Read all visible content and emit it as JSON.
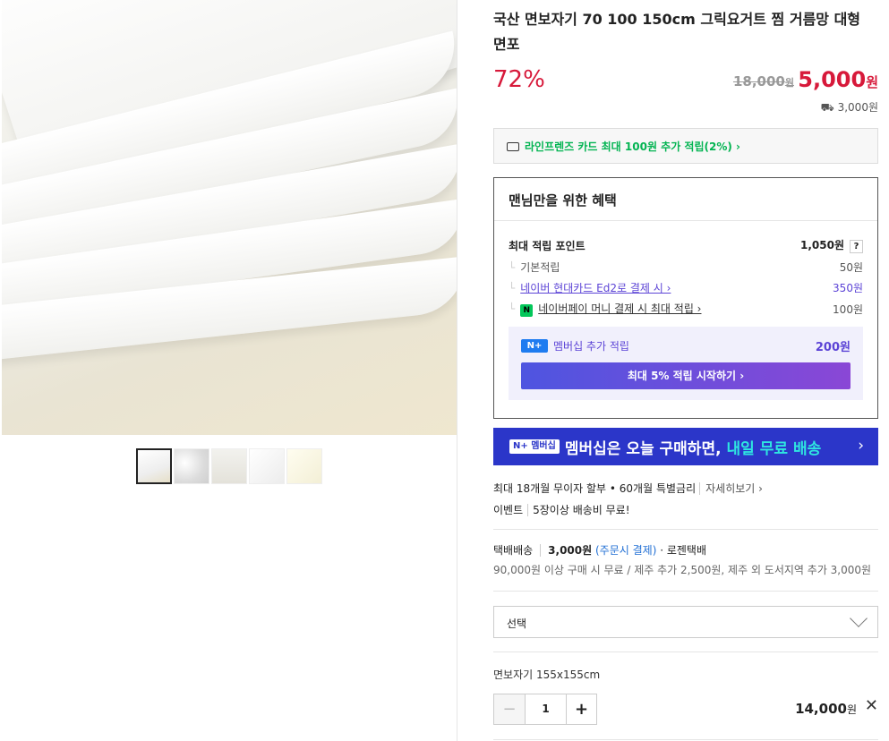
{
  "product": {
    "title": "국산 면보자기 70 100 150cm 그릭요거트 찜 거름망 대형 면포",
    "discount": "72%",
    "original_price": "18,000",
    "original_unit": "원",
    "price": "5,000",
    "price_unit": "원",
    "shipping_fee": "3,000원"
  },
  "card_promo": "라인프렌즈 카드 최대 100원 추가 적립(2%) ›",
  "benefit": {
    "heading": "맨님만을 위한 혜택",
    "max_points_label": "최대 적립 포인트",
    "max_points_value": "1,050원",
    "help_icon": "?",
    "items": [
      {
        "label": "기본적립",
        "value": "50원"
      },
      {
        "label": "네이버 현대카드 Ed2로 결제 시 ›",
        "value": "350원"
      },
      {
        "label": "네이버페이 머니 결제 시 최대 적립 ›",
        "value": "100원"
      }
    ],
    "npay_icon": "N",
    "membership": {
      "badge": "N+",
      "label": "멤버십 추가 적립",
      "points": "200원",
      "button": "최대 5% 적립 시작하기 ›"
    }
  },
  "banner": {
    "badge": "N+ 멤버십",
    "text": "멤버십은 오늘 구매하면,",
    "highlight": "내일 무료 배송",
    "arrow": "›"
  },
  "installment": {
    "text": "최대 18개월 무이자 할부 • 60개월 특별금리",
    "more": "자세히보기 ›"
  },
  "event": {
    "label": "이벤트",
    "text": "5장이상 배송비 무료!"
  },
  "shipping": {
    "method": "택배배송",
    "fee": "3,000원",
    "fee_note": "(주문시 결제)",
    "carrier": "· 로젠택배",
    "note": "90,000원 이상 구매 시 무료 / 제주 추가 2,500원, 제주 외 도서지역 추가 3,000원"
  },
  "option_select": {
    "placeholder": "선택"
  },
  "selected_option": {
    "name": "면보자기 155x155cm",
    "quantity": "1",
    "minus": "−",
    "plus": "+",
    "price": "14,000",
    "price_unit": "원",
    "remove": "✕"
  }
}
